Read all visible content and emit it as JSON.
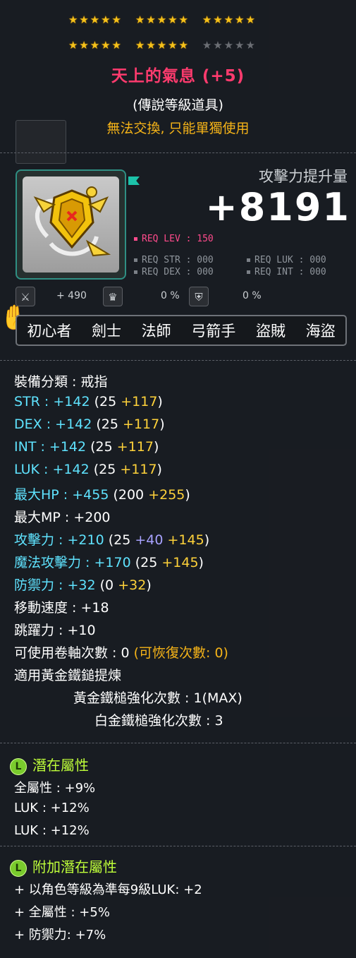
{
  "stars": {
    "row1": [
      true,
      true,
      true,
      true,
      true,
      true,
      true,
      true,
      true,
      true,
      true,
      true,
      true,
      true,
      true
    ],
    "row2": [
      true,
      true,
      true,
      true,
      true,
      true,
      true,
      true,
      true,
      true,
      false,
      false,
      false,
      false,
      false
    ]
  },
  "item": {
    "name": "天上的氣息 (+5)",
    "grade": "(傳說等級道具)",
    "trade": "無法交換, 只能單獨使用"
  },
  "attack_gain": {
    "label": "攻擊力提升量",
    "value": "+8191"
  },
  "requirements": {
    "lev": "REQ LEV : 150",
    "str": "REQ STR : 000",
    "luk": "REQ LUK : 000",
    "dex": "REQ DEX : 000",
    "int": "REQ INT : 000"
  },
  "extra": {
    "value1": "+ 490",
    "value2": "0 %",
    "value3": "0 %"
  },
  "jobs": [
    "初心者",
    "劍士",
    "法師",
    "弓箭手",
    "盜賊",
    "海盜"
  ],
  "stats": {
    "category": "裝備分類 : 戒指",
    "str": {
      "label": "STR",
      "sep": " : ",
      "total": "+142",
      "base": " (25 ",
      "bonus": "+117",
      "end": ")"
    },
    "dex": {
      "label": "DEX",
      "sep": " : ",
      "total": "+142",
      "base": " (25 ",
      "bonus": "+117",
      "end": ")"
    },
    "int": {
      "label": "INT",
      "sep": " : ",
      "total": "+142",
      "base": " (25 ",
      "bonus": "+117",
      "end": ")"
    },
    "luk": {
      "label": "LUK",
      "sep": " : ",
      "total": "+142",
      "base": " (25 ",
      "bonus": "+117",
      "end": ")"
    },
    "hp": {
      "label": "最大HP",
      "sep": " : ",
      "total": "+455",
      "base": " (200 ",
      "bonus": "+255",
      "end": ")"
    },
    "mp": "最大MP : +200",
    "atk": {
      "label": "攻擊力",
      "sep": " : ",
      "total": "+210",
      "base": " (25 ",
      "star": "+40",
      "bonus": "+145",
      "end": ")"
    },
    "matk": {
      "label": "魔法攻擊力",
      "sep": " : ",
      "total": "+170",
      "base": " (25 ",
      "bonus": "+145",
      "end": ")"
    },
    "def": {
      "label": "防禦力",
      "sep": " : ",
      "total": "+32",
      "base": " (0 ",
      "bonus": "+32",
      "end": ")"
    },
    "speed": "移動速度 : +18",
    "jump": "跳躍力 : +10",
    "slots": "可使用卷軸次數 : 0",
    "slots_recover": " (可恢復次數: 0)",
    "hammer": "適用黃金鐵鎚提煉",
    "gold_hammer": "黃金鐵槌強化次數 : 1(MAX)",
    "platinum_hammer": "白金鐵槌強化次數 : 3"
  },
  "potential": {
    "badge": "L",
    "title": "潛在屬性",
    "lines": [
      "全屬性 : +9%",
      "LUK : +12%",
      "LUK : +12%"
    ]
  },
  "bonus_potential": {
    "badge": "L",
    "title": "附加潛在屬性",
    "lines": [
      "+ 以角色等級為準每9級LUK: +2",
      "+ 全屬性 : +5%",
      "+ 防禦力: +7%"
    ]
  },
  "colors": {
    "name": "#ff3b6e",
    "trade": "#f5b318",
    "stat_label": "#5fe3ff",
    "bonus": "#ffd23a",
    "star_force": "#a8a2ff",
    "potential": "#bfff3a",
    "frame": "#2f8f83"
  }
}
